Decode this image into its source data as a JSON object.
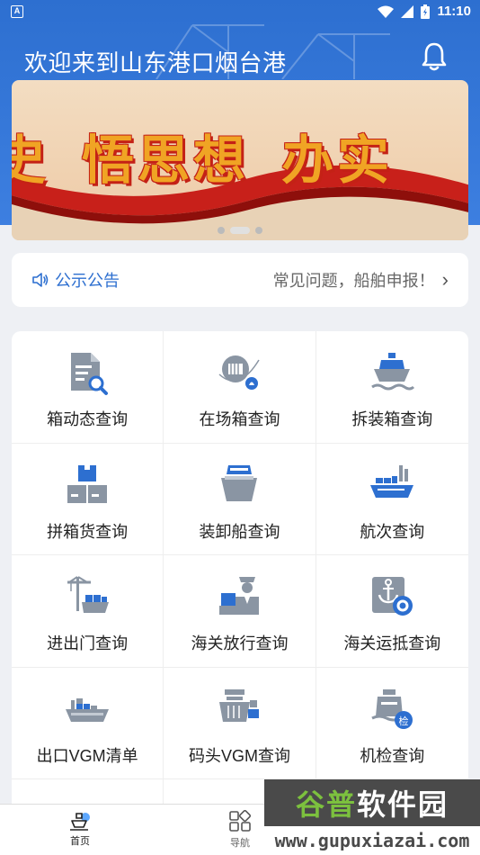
{
  "status_bar": {
    "time": "11:10",
    "left_badge": "A"
  },
  "header": {
    "title": "欢迎来到山东港口烟台港"
  },
  "banner": {
    "text_parts": [
      "史",
      "悟思想",
      "办实"
    ],
    "slide_count": 3,
    "active_slide": 1
  },
  "notice": {
    "label": "公示公告",
    "content": "常见问题，船舶申报！"
  },
  "grid": {
    "items": [
      {
        "label": "箱动态查询",
        "icon": "document-search-icon"
      },
      {
        "label": "在场箱查询",
        "icon": "yard-container-icon"
      },
      {
        "label": "拆装箱查询",
        "icon": "cargo-ship-icon"
      },
      {
        "label": "拼箱货查询",
        "icon": "stacked-boxes-icon"
      },
      {
        "label": "装卸船查询",
        "icon": "ship-loading-icon"
      },
      {
        "label": "航次查询",
        "icon": "container-ship-icon"
      },
      {
        "label": "进出门查询",
        "icon": "crane-truck-icon"
      },
      {
        "label": "海关放行查询",
        "icon": "customs-officer-icon"
      },
      {
        "label": "海关运抵查询",
        "icon": "anchor-arrival-icon"
      },
      {
        "label": "出口VGM清单",
        "icon": "export-vgm-icon"
      },
      {
        "label": "码头VGM查询",
        "icon": "terminal-vgm-icon"
      },
      {
        "label": "机检查询",
        "icon": "machine-inspection-icon"
      }
    ],
    "inspection_badge": "检"
  },
  "bottom_nav": {
    "items": [
      {
        "label": "首页",
        "icon": "home-ship-icon",
        "active": true
      },
      {
        "label": "导航",
        "icon": "grid-nav-icon",
        "active": false
      }
    ]
  },
  "watermark": {
    "title_part1": "谷普",
    "title_part2": "软件园",
    "url": "www.gupuxiazai.com"
  },
  "colors": {
    "primary": "#2d6fd0",
    "icon_gray": "#8a95a3",
    "icon_blue": "#2d6fd0"
  }
}
